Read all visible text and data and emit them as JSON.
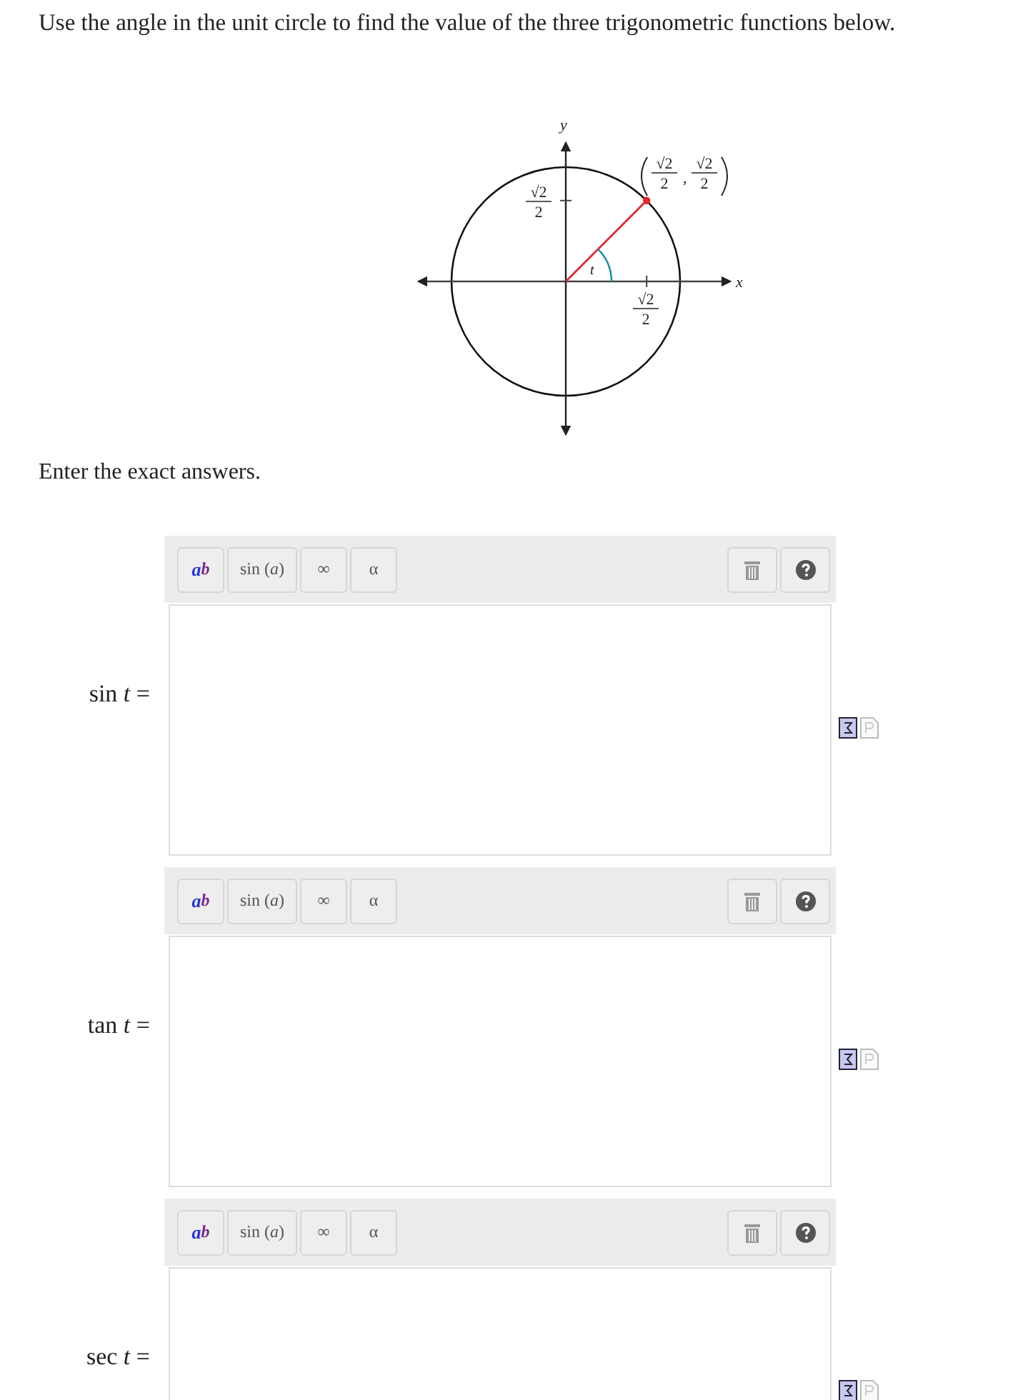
{
  "instruction": "Use the angle in the unit circle to find the value of the three trigonometric functions below.",
  "diagram": {
    "y_axis_label": "y",
    "x_axis_label": "x",
    "angle_label": "t",
    "y_tick_label": {
      "numerator": "√2",
      "denominator": "2"
    },
    "x_tick_label": {
      "numerator": "√2",
      "denominator": "2"
    },
    "point_label": {
      "x": {
        "numerator": "√2",
        "denominator": "2"
      },
      "separator": ",",
      "y": {
        "numerator": "√2",
        "denominator": "2"
      }
    }
  },
  "prompt": "Enter the exact answers.",
  "answers": [
    {
      "label": "sin *t* =",
      "toolbar": [
        {
          "kind": "power",
          "base": "a",
          "exponent": "b"
        },
        {
          "kind": "function",
          "text": "sin (*a*)"
        },
        {
          "kind": "symbol",
          "text": "∞"
        },
        {
          "kind": "symbol",
          "text": "α"
        }
      ]
    },
    {
      "label": "tan *t* =",
      "toolbar": [
        {
          "kind": "power",
          "base": "a",
          "exponent": "b"
        },
        {
          "kind": "function",
          "text": "sin (*a*)"
        },
        {
          "kind": "symbol",
          "text": "∞"
        },
        {
          "kind": "symbol",
          "text": "α"
        }
      ]
    },
    {
      "label": "sec *t* =",
      "toolbar": [
        {
          "kind": "power",
          "base": "a",
          "exponent": "b"
        },
        {
          "kind": "function",
          "text": "sin (*a*)"
        },
        {
          "kind": "symbol",
          "text": "∞"
        },
        {
          "kind": "symbol",
          "text": "α"
        }
      ]
    }
  ]
}
